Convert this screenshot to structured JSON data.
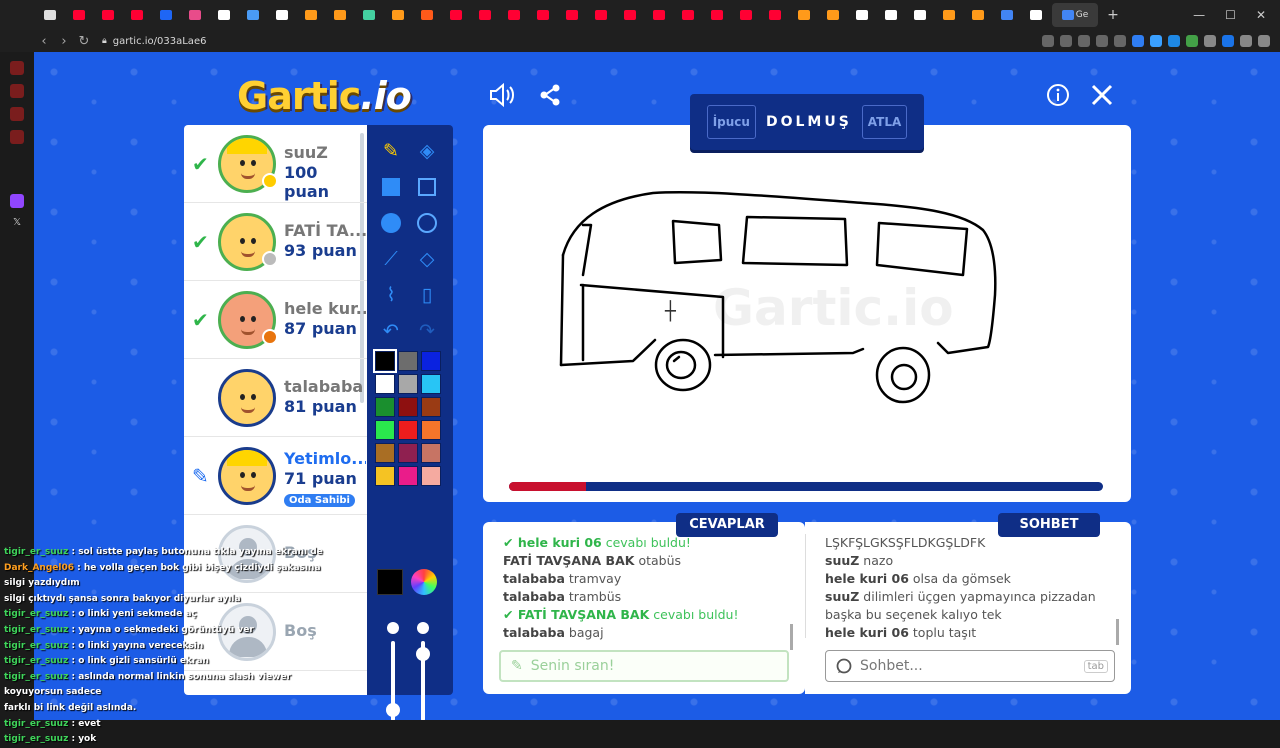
{
  "browser": {
    "url": "gartic.io/033aLae6",
    "active_tab_label": "Ge",
    "tab_colors": [
      "#e0e0e0",
      "#ff0033",
      "#ff0033",
      "#ff0033",
      "#1e66f5",
      "#e84c8a",
      "#ffffff",
      "#4a9bf5",
      "#ffffff",
      "#ff9a1a",
      "#ff9a1a",
      "#44d0a0",
      "#ff9a1a",
      "#ff5a1a",
      "#ff0033",
      "#ff0033",
      "#ff0033",
      "#ff0033",
      "#ff0033",
      "#ff0033",
      "#ff0033",
      "#ff0033",
      "#ff0033",
      "#ff0033",
      "#ff0033",
      "#ff0033",
      "#ff9a1a",
      "#ff9a1a",
      "#ffffff",
      "#ffffff",
      "#ffffff",
      "#ff9a1a",
      "#ff9a1a",
      "#4285f4",
      "#ffffff"
    ]
  },
  "game": {
    "logo_main": "Gartic",
    "logo_io": ".io",
    "hint_button": "İpucu",
    "word": "DOLMUŞ",
    "skip_button": "ATLA",
    "timer_fraction": 0.13
  },
  "players": [
    {
      "name": "suuZ",
      "score": "100 puan",
      "guessed": true,
      "status_color": "#ffcc00",
      "avatar_color": "#ffd36a",
      "hat": true
    },
    {
      "name": "FATİ TA...",
      "score": "93 puan",
      "guessed": true,
      "status_color": "#bbbbbb",
      "avatar_color": "#ffd36a",
      "hat": false
    },
    {
      "name": "hele kur...",
      "score": "87 puan",
      "guessed": true,
      "status_color": "#e8740d",
      "avatar_color": "#f4a07a",
      "hat": false
    },
    {
      "name": "talababa",
      "score": "81 puan",
      "guessed": false,
      "status_color": "",
      "avatar_color": "#ffd36a",
      "hat": false
    },
    {
      "name": "Yetimlo...",
      "score": "71 puan",
      "guessed": false,
      "drawing": true,
      "owner_badge": "Oda Sahibi",
      "avatar_color": "#ffd36a",
      "hat": true
    },
    {
      "name": "Boş",
      "empty": true
    },
    {
      "name": "Boş",
      "empty": true
    }
  ],
  "palette": [
    "#000000",
    "#6d6d6d",
    "#0a22e0",
    "#ffffff",
    "#a8a8a8",
    "#28c5f5",
    "#1a8f2e",
    "#8e1010",
    "#9a3b14",
    "#2ae84d",
    "#ee1d1d",
    "#f5752a",
    "#a96e24",
    "#8f2050",
    "#c77464",
    "#f5c323",
    "#ea1c8a",
    "#f5aaa0"
  ],
  "current_color": "#000000",
  "answers": {
    "title": "CEVAPLAR",
    "messages": [
      {
        "user": "hele kuri 06",
        "text": "cevabı buldu!",
        "correct": true
      },
      {
        "user": "FATİ TAVŞANA BAK",
        "text": "otabüs"
      },
      {
        "user": "talababa",
        "text": "tramvay"
      },
      {
        "user": "talababa",
        "text": "trambüs"
      },
      {
        "user": "FATİ TAVŞANA BAK",
        "text": "cevabı buldu!",
        "correct": true
      },
      {
        "user": "talababa",
        "text": "bagaj"
      }
    ],
    "placeholder": "Senin sıran!"
  },
  "chat": {
    "title": "SOHBET",
    "messages": [
      {
        "user": "",
        "text": "LŞKFŞLGKSŞFLDKGŞLDFK"
      },
      {
        "user": "suuZ",
        "text": "nazo"
      },
      {
        "user": "hele kuri 06",
        "text": "olsa da gömsek"
      },
      {
        "user": "suuZ",
        "text": "dilimleri üçgen yapmayınca pizzadan başka bu seçenek kalıyo tek"
      },
      {
        "user": "hele kuri 06",
        "text": "toplu taşıt"
      }
    ],
    "placeholder": "Sohbet...",
    "tab_hint": "tab"
  },
  "stream_chat": [
    {
      "user": "tigir_er_suuz",
      "text": "sol üstte paylaş butonuna tıkla yayına ekranı de"
    },
    {
      "user": "Dark_Angel06",
      "text": "he volla geçen bok gibi bişey çizdiydi şakasına silgi yazdıydım"
    },
    {
      "user": "",
      "text": "silgi çıktıydı şansa sonra bakıyor diyurlar ayıla"
    },
    {
      "user": "tigir_er_suuz",
      "text": "o linki yeni sekmede aç"
    },
    {
      "user": "tigir_er_suuz",
      "text": "yayına o sekmedeki görüntüyü ver"
    },
    {
      "user": "tigir_er_suuz",
      "text": "o linki yayına vereceksin"
    },
    {
      "user": "tigir_er_suuz",
      "text": "o link gizli sansürlü ekran"
    },
    {
      "user": "tigir_er_suuz",
      "text": "aslında normal linkin sonuna slash viewer koyuyorsun sadece"
    },
    {
      "user": "",
      "text": "farklı bi link değil aslında."
    },
    {
      "user": "tigir_er_suuz",
      "text": "evet"
    },
    {
      "user": "tigir_er_suuz",
      "text": "yok"
    }
  ]
}
